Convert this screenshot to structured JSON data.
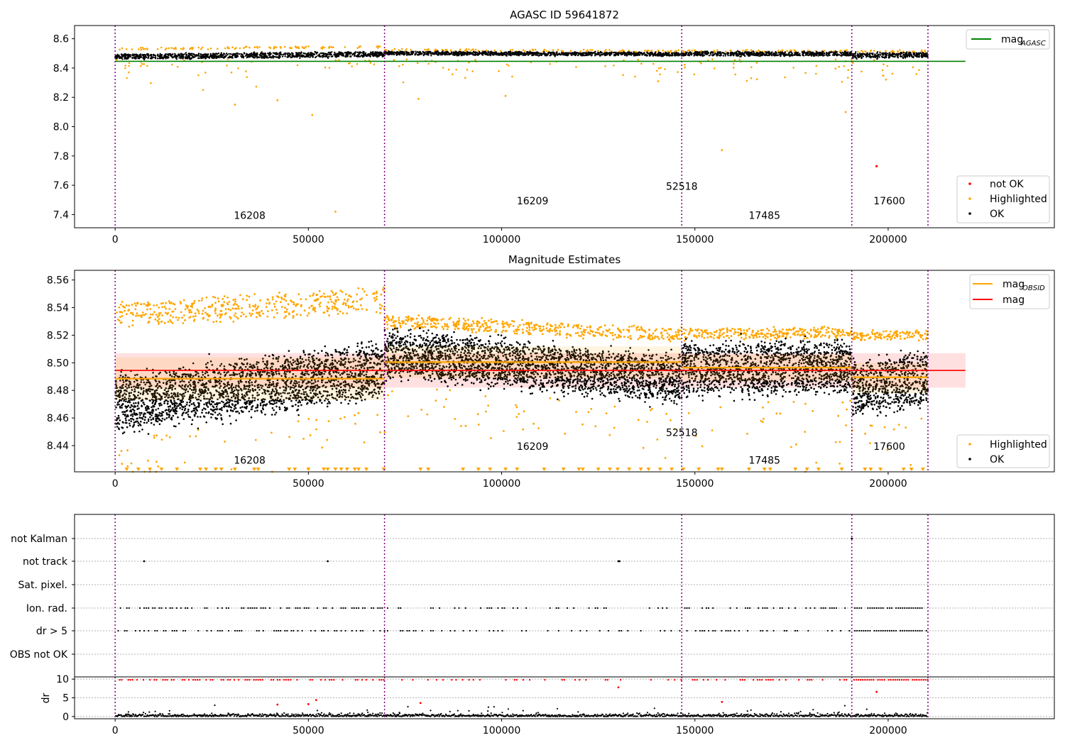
{
  "chart_data": [
    {
      "type": "scatter",
      "title": "AGASC ID 59641872",
      "xlim": [
        -10500,
        243000
      ],
      "ylim": [
        7.31,
        8.69
      ],
      "x_ticks": [
        0,
        50000,
        100000,
        150000,
        200000
      ],
      "x_tick_labels": [
        "0",
        "50000",
        "100000",
        "150000",
        "200000"
      ],
      "y_ticks": [
        7.4,
        7.6,
        7.8,
        8.0,
        8.2,
        8.4,
        8.6
      ],
      "y_tick_labels": [
        "7.4",
        "7.6",
        "7.8",
        "8.0",
        "8.2",
        "8.4",
        "8.6"
      ],
      "obs_boundaries": [
        0,
        69700,
        146600,
        190600,
        210300
      ],
      "obs_labels": [
        {
          "text": "16208",
          "x": 34800,
          "y": 7.37
        },
        {
          "text": "16209",
          "x": 108000,
          "y": 7.47
        },
        {
          "text": "52518",
          "x": 146600,
          "y": 7.57
        },
        {
          "text": "17485",
          "x": 168000,
          "y": 7.37
        },
        {
          "text": "17600",
          "x": 200300,
          "y": 7.47
        }
      ],
      "segments": [
        {
          "start": 0,
          "end": 69700,
          "ok_center_from": 8.476,
          "ok_center_to": 8.495,
          "ok_halfwidth": 0.022,
          "hl_center_from": 8.53,
          "hl_center_to": 8.545
        },
        {
          "start": 69700,
          "end": 146600,
          "ok_center_from": 8.502,
          "ok_center_to": 8.494,
          "ok_halfwidth": 0.016,
          "hl_center_from": 8.525,
          "hl_center_to": 8.515
        },
        {
          "start": 146600,
          "end": 190600,
          "ok_center_from": 8.497,
          "ok_center_to": 8.497,
          "ok_halfwidth": 0.018,
          "hl_center_from": 8.516,
          "hl_center_to": 8.516
        },
        {
          "start": 190600,
          "end": 210300,
          "ok_center_from": 8.484,
          "ok_center_to": 8.49,
          "ok_halfwidth": 0.022,
          "hl_center_from": 8.515,
          "hl_center_to": 8.515
        }
      ],
      "series": [
        {
          "name": "mag_AGASC",
          "kind": "hline",
          "y": 8.446,
          "x_range": [
            0,
            220000
          ],
          "color": "#008000"
        },
        {
          "name": "not OK",
          "kind": "points",
          "color": "#ff0000",
          "x": [
            197000
          ],
          "y": [
            7.73
          ]
        },
        {
          "name": "Highlighted",
          "kind": "band-points",
          "color": "#ffa500",
          "outliers_x": [
            31000,
            42000,
            51000,
            57000,
            78500,
            101000,
            140500,
            157000,
            189000
          ],
          "outliers_y": [
            8.15,
            8.18,
            8.08,
            7.42,
            8.19,
            8.21,
            8.31,
            7.84,
            8.1
          ]
        },
        {
          "name": "OK",
          "kind": "band-points",
          "color": "#000000"
        }
      ],
      "legends": [
        {
          "entries": [
            {
              "label": "mag",
              "subscript": "AGASC",
              "color": "#008000",
              "marker": "line"
            }
          ],
          "placement": "upper right"
        },
        {
          "entries": [
            {
              "label": "not OK",
              "color": "#ff0000",
              "marker": "dot"
            },
            {
              "label": "Highlighted",
              "color": "#ffa500",
              "marker": "dot"
            },
            {
              "label": "OK",
              "color": "#000000",
              "marker": "dot"
            }
          ],
          "placement": "lower right"
        }
      ]
    },
    {
      "type": "scatter",
      "title": "Magnitude Estimates",
      "xlim": [
        -10500,
        243000
      ],
      "ylim": [
        8.421,
        8.567
      ],
      "x_ticks": [
        0,
        50000,
        100000,
        150000,
        200000
      ],
      "x_tick_labels": [
        "0",
        "50000",
        "100000",
        "150000",
        "200000"
      ],
      "y_ticks": [
        8.44,
        8.46,
        8.48,
        8.5,
        8.52,
        8.54,
        8.56
      ],
      "y_tick_labels": [
        "8.44",
        "8.46",
        "8.48",
        "8.50",
        "8.52",
        "8.54",
        "8.56"
      ],
      "obs_boundaries": [
        0,
        69700,
        146600,
        190600,
        210300
      ],
      "obs_labels": [
        {
          "text": "16208",
          "x": 34800,
          "y": 8.427
        },
        {
          "text": "16209",
          "x": 108000,
          "y": 8.437
        },
        {
          "text": "52518",
          "x": 146600,
          "y": 8.447
        },
        {
          "text": "17485",
          "x": 168000,
          "y": 8.427
        },
        {
          "text": "17600",
          "x": 200300,
          "y": 8.437
        }
      ],
      "mag": {
        "value": 8.4945,
        "band": [
          8.482,
          8.507
        ],
        "color": "#ff0000",
        "x_range": [
          0,
          220000
        ]
      },
      "mag_obsid": [
        {
          "start": 0,
          "end": 69700,
          "value": 8.4885,
          "band": [
            8.473,
            8.504
          ]
        },
        {
          "start": 69700,
          "end": 146600,
          "value": 8.5005,
          "band": [
            8.489,
            8.512
          ]
        },
        {
          "start": 146600,
          "end": 190600,
          "value": 8.4965,
          "band": [
            8.487,
            8.506
          ]
        },
        {
          "start": 190600,
          "end": 210300,
          "value": 8.4895,
          "band": [
            8.478,
            8.5
          ]
        }
      ],
      "segments": [
        {
          "start": 0,
          "end": 69700,
          "ok_center_from": 8.47,
          "ok_center_to": 8.495,
          "ok_halfwidth": 0.024,
          "hl_center_from": 8.535,
          "hl_center_to": 8.545,
          "hl_halfwidth": 0.011
        },
        {
          "start": 69700,
          "end": 146600,
          "ok_center_from": 8.507,
          "ok_center_to": 8.488,
          "ok_halfwidth": 0.02,
          "hl_center_from": 8.53,
          "hl_center_to": 8.52,
          "hl_halfwidth": 0.006
        },
        {
          "start": 146600,
          "end": 190600,
          "ok_center_from": 8.495,
          "ok_center_to": 8.497,
          "ok_halfwidth": 0.022,
          "hl_center_from": 8.521,
          "hl_center_to": 8.522,
          "hl_halfwidth": 0.005
        },
        {
          "start": 190600,
          "end": 210300,
          "ok_center_from": 8.48,
          "ok_center_to": 8.49,
          "ok_halfwidth": 0.024,
          "hl_center_from": 8.519,
          "hl_center_to": 8.52,
          "hl_halfwidth": 0.004
        }
      ],
      "series": [
        {
          "name": "Highlighted",
          "kind": "band-points",
          "color": "#ffa500"
        },
        {
          "name": "OK",
          "kind": "band-points",
          "color": "#000000"
        }
      ],
      "clipped_low_markers_x": [
        3000,
        6000,
        9000,
        12000,
        16000,
        22000,
        23500,
        26000,
        27500,
        31000,
        36000,
        37000,
        45000,
        46500,
        50000,
        54000,
        55000,
        57000,
        58500,
        60000,
        62000,
        63000,
        65000,
        69500,
        79000,
        81000,
        90000,
        94000,
        97000,
        101000,
        104000,
        111000,
        116000,
        120000,
        121000,
        125000,
        128000,
        130000,
        133000,
        136000,
        138000,
        141000,
        144000,
        147000,
        151000,
        156000,
        157000,
        164000,
        168000,
        169500,
        176000,
        179000,
        182000,
        188000,
        194000,
        195500,
        198000,
        204000,
        206000,
        209000
      ],
      "legends": [
        {
          "entries": [
            {
              "label": "mag",
              "subscript": "OBSID",
              "color": "#ffa500",
              "marker": "line"
            },
            {
              "label": "mag",
              "color": "#ff0000",
              "marker": "line"
            }
          ],
          "placement": "upper right"
        },
        {
          "entries": [
            {
              "label": "Highlighted",
              "color": "#ffa500",
              "marker": "dot"
            },
            {
              "label": "OK",
              "color": "#000000",
              "marker": "dot"
            }
          ],
          "placement": "lower right"
        }
      ]
    },
    {
      "type": "scatter",
      "title": "",
      "xlim": [
        -10500,
        243000
      ],
      "categories": [
        "not Kalman",
        "not track",
        "Sat. pixel.",
        "Ion. rad.",
        "dr > 5",
        "OBS not OK"
      ],
      "obs_boundaries": [
        0,
        69700,
        146600,
        190600,
        210300
      ],
      "flags": [
        {
          "category": "not Kalman",
          "x": [
            190600
          ]
        },
        {
          "category": "not track",
          "x": [
            7500,
            55000,
            130200,
            130500
          ]
        },
        {
          "category": "Sat. pixel.",
          "x": []
        },
        {
          "category": "Ion. rad.",
          "kind": "dense-dots"
        },
        {
          "category": "dr > 5",
          "kind": "dense-dots"
        },
        {
          "category": "OBS not OK",
          "x": []
        }
      ]
    },
    {
      "type": "scatter",
      "title": "",
      "ylabel": "dr",
      "xlim": [
        -10500,
        243000
      ],
      "ylim": [
        -0.6,
        10.6
      ],
      "x_ticks": [
        0,
        50000,
        100000,
        150000,
        200000
      ],
      "x_tick_labels": [
        "0",
        "50000",
        "100000",
        "150000",
        "200000"
      ],
      "y_ticks": [
        0,
        5,
        10
      ],
      "y_tick_labels": [
        "0",
        "5",
        "10"
      ],
      "obs_boundaries": [
        0,
        69700,
        146600,
        190600,
        210300
      ],
      "series": [
        {
          "name": "dr OK",
          "color": "#000000",
          "kind": "dense-dots",
          "baseline": 0.3
        },
        {
          "name": "dr clipped",
          "color": "#ff0000",
          "kind": "clipped",
          "y": 9.8
        },
        {
          "name": "dr outliers",
          "color": "#ff0000",
          "x": [
            42000,
            50000,
            52000,
            79000,
            130200,
            157000,
            197000
          ],
          "y": [
            3.2,
            3.3,
            4.4,
            3.6,
            7.8,
            3.9,
            6.6
          ]
        }
      ]
    }
  ]
}
